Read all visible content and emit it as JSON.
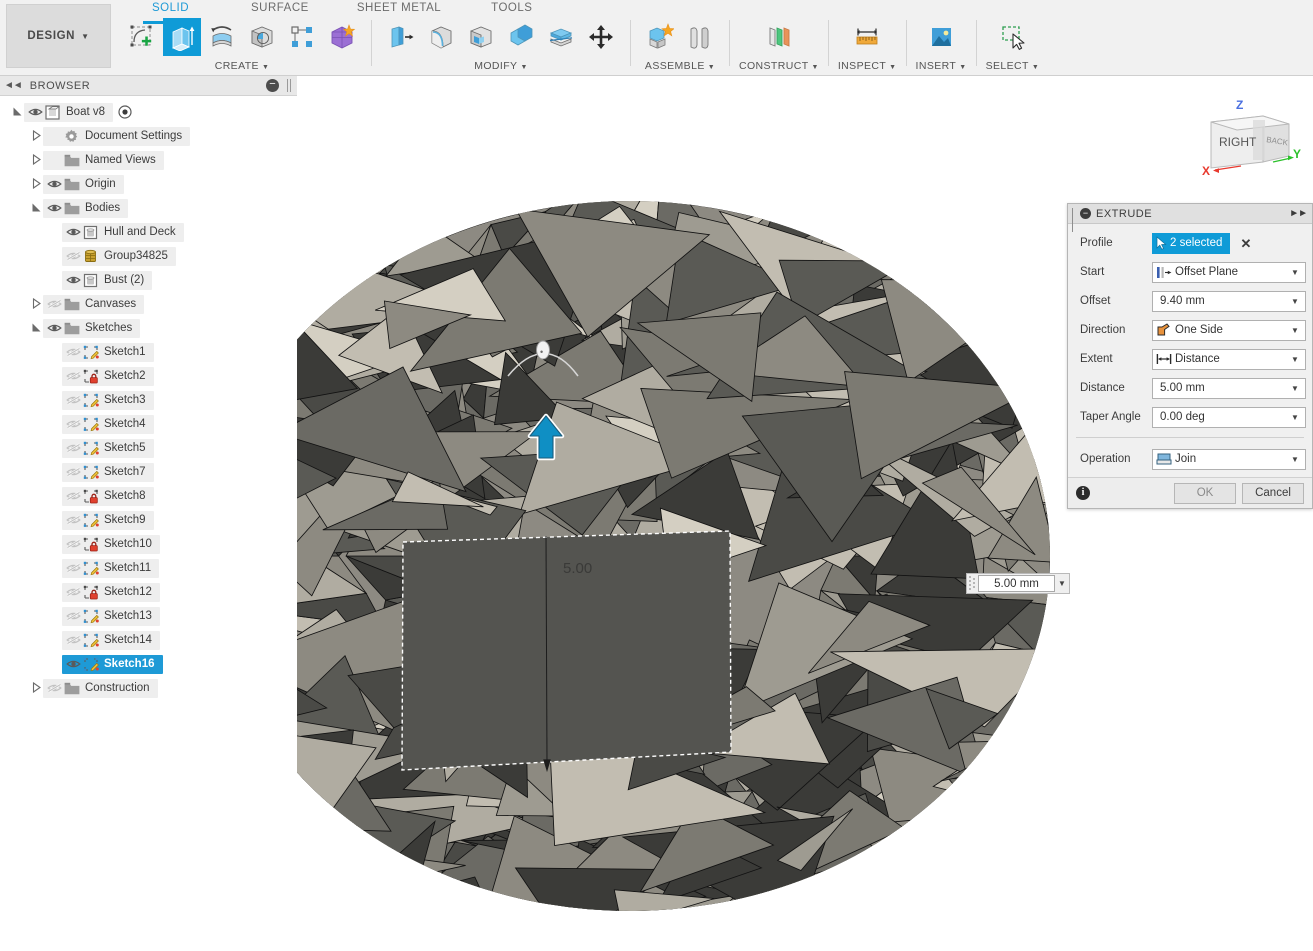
{
  "app": {
    "workspace_button": "DESIGN",
    "tabs": [
      {
        "label": "SOLID",
        "active": true
      },
      {
        "label": "SURFACE",
        "active": false
      },
      {
        "label": "SHEET METAL",
        "active": false
      },
      {
        "label": "TOOLS",
        "active": false
      }
    ],
    "tool_groups": [
      {
        "label": "CREATE",
        "has_caret": true,
        "tools": [
          {
            "name": "create-sketch-icon",
            "selected": false
          },
          {
            "name": "extrude-icon",
            "selected": true
          },
          {
            "name": "revolve-icon",
            "selected": false
          },
          {
            "name": "sweep-icon",
            "selected": false
          },
          {
            "name": "pattern-icon",
            "selected": false
          },
          {
            "name": "form-icon",
            "selected": false
          }
        ]
      },
      {
        "label": "MODIFY",
        "has_caret": true,
        "tools": [
          {
            "name": "press-pull-icon",
            "selected": false
          },
          {
            "name": "fillet-icon",
            "selected": false
          },
          {
            "name": "shell-icon",
            "selected": false
          },
          {
            "name": "combine-icon",
            "selected": false
          },
          {
            "name": "split-face-icon",
            "selected": false
          },
          {
            "name": "move-copy-icon",
            "selected": false
          }
        ]
      },
      {
        "label": "ASSEMBLE",
        "has_caret": true,
        "tools": [
          {
            "name": "new-component-icon",
            "selected": false
          },
          {
            "name": "joint-icon",
            "selected": false
          }
        ]
      },
      {
        "label": "CONSTRUCT",
        "has_caret": true,
        "tools": [
          {
            "name": "offset-plane-icon",
            "selected": false
          }
        ]
      },
      {
        "label": "INSPECT",
        "has_caret": true,
        "tools": [
          {
            "name": "measure-icon",
            "selected": false
          }
        ]
      },
      {
        "label": "INSERT",
        "has_caret": true,
        "tools": [
          {
            "name": "insert-image-icon",
            "selected": false
          }
        ]
      },
      {
        "label": "SELECT",
        "has_caret": true,
        "tools": [
          {
            "name": "select-window-icon",
            "selected": false
          }
        ]
      }
    ]
  },
  "browser": {
    "title": "BROWSER",
    "collapse_icon": "collapse-left-icon",
    "minus_icon": "minus-circle-icon",
    "tree": [
      {
        "label": "Boat v8",
        "indent": 0,
        "expander": "open",
        "eye": "visible",
        "icon": "component-icon",
        "selected": false,
        "extra": "activate-radio-icon"
      },
      {
        "label": "Document Settings",
        "indent": 1,
        "expander": "closed",
        "eye": "none",
        "icon": "gear-icon",
        "selected": false
      },
      {
        "label": "Named Views",
        "indent": 1,
        "expander": "closed",
        "eye": "none",
        "icon": "folder-icon",
        "selected": false
      },
      {
        "label": "Origin",
        "indent": 1,
        "expander": "closed",
        "eye": "visible",
        "icon": "folder-icon",
        "selected": false
      },
      {
        "label": "Bodies",
        "indent": 1,
        "expander": "open",
        "eye": "visible",
        "icon": "folder-icon",
        "selected": false
      },
      {
        "label": "Hull and Deck",
        "indent": 2,
        "expander": "none",
        "eye": "visible",
        "icon": "body-icon",
        "selected": false
      },
      {
        "label": "Group34825",
        "indent": 2,
        "expander": "none",
        "eye": "hidden",
        "icon": "mesh-body-icon",
        "selected": false
      },
      {
        "label": "Bust (2)",
        "indent": 2,
        "expander": "none",
        "eye": "visible",
        "icon": "body-icon",
        "selected": false
      },
      {
        "label": "Canvases",
        "indent": 1,
        "expander": "closed",
        "eye": "hidden",
        "icon": "folder-icon",
        "selected": false
      },
      {
        "label": "Sketches",
        "indent": 1,
        "expander": "open",
        "eye": "visible",
        "icon": "folder-icon",
        "selected": false
      },
      {
        "label": "Sketch1",
        "indent": 2,
        "expander": "none",
        "eye": "hidden",
        "icon": "sketch-icon",
        "selected": false
      },
      {
        "label": "Sketch2",
        "indent": 2,
        "expander": "none",
        "eye": "hidden",
        "icon": "sketch-locked-icon",
        "selected": false
      },
      {
        "label": "Sketch3",
        "indent": 2,
        "expander": "none",
        "eye": "hidden",
        "icon": "sketch-icon",
        "selected": false
      },
      {
        "label": "Sketch4",
        "indent": 2,
        "expander": "none",
        "eye": "hidden",
        "icon": "sketch-icon",
        "selected": false
      },
      {
        "label": "Sketch5",
        "indent": 2,
        "expander": "none",
        "eye": "hidden",
        "icon": "sketch-icon",
        "selected": false
      },
      {
        "label": "Sketch7",
        "indent": 2,
        "expander": "none",
        "eye": "hidden",
        "icon": "sketch-icon",
        "selected": false
      },
      {
        "label": "Sketch8",
        "indent": 2,
        "expander": "none",
        "eye": "hidden",
        "icon": "sketch-locked-icon",
        "selected": false
      },
      {
        "label": "Sketch9",
        "indent": 2,
        "expander": "none",
        "eye": "hidden",
        "icon": "sketch-icon",
        "selected": false
      },
      {
        "label": "Sketch10",
        "indent": 2,
        "expander": "none",
        "eye": "hidden",
        "icon": "sketch-locked-icon",
        "selected": false
      },
      {
        "label": "Sketch11",
        "indent": 2,
        "expander": "none",
        "eye": "hidden",
        "icon": "sketch-icon",
        "selected": false
      },
      {
        "label": "Sketch12",
        "indent": 2,
        "expander": "none",
        "eye": "hidden",
        "icon": "sketch-locked-icon",
        "selected": false
      },
      {
        "label": "Sketch13",
        "indent": 2,
        "expander": "none",
        "eye": "hidden",
        "icon": "sketch-icon",
        "selected": false
      },
      {
        "label": "Sketch14",
        "indent": 2,
        "expander": "none",
        "eye": "hidden",
        "icon": "sketch-icon",
        "selected": false
      },
      {
        "label": "Sketch16",
        "indent": 2,
        "expander": "none",
        "eye": "visible",
        "icon": "sketch-icon",
        "selected": true
      },
      {
        "label": "Construction",
        "indent": 1,
        "expander": "closed",
        "eye": "hidden",
        "icon": "folder-icon",
        "selected": false
      }
    ]
  },
  "viewcube": {
    "face_label": "RIGHT",
    "axis_x": "X",
    "axis_y": "Y",
    "axis_z": "Z",
    "color_x": "#e8392e",
    "color_y": "#2cc12c",
    "color_z": "#4a6fe0"
  },
  "canvas": {
    "dimension_text": "5.00",
    "inline_input_value": "5.00 mm",
    "manipulator_arrow": "extrude-direction-arrow-icon",
    "taper_handle": "taper-angle-handle-icon"
  },
  "dialog": {
    "title": "EXTRUDE",
    "collapse_icon": "minus-circle-icon",
    "expand_icon": "expand-right-icon",
    "rows": [
      {
        "label": "Profile",
        "kind": "selection",
        "value": "2 selected",
        "icon": "cursor-select-icon",
        "clear": "✕"
      },
      {
        "label": "Start",
        "kind": "dropdown",
        "value": "Offset Plane",
        "icon": "offset-plane-icon"
      },
      {
        "label": "Offset",
        "kind": "value",
        "value": "9.40 mm",
        "icon": ""
      },
      {
        "label": "Direction",
        "kind": "dropdown",
        "value": "One Side",
        "icon": "one-side-arrow-icon"
      },
      {
        "label": "Extent",
        "kind": "dropdown",
        "value": "Distance",
        "icon": "distance-arrows-icon"
      },
      {
        "label": "Distance",
        "kind": "value",
        "value": "5.00 mm",
        "icon": ""
      },
      {
        "label": "Taper Angle",
        "kind": "value",
        "value": "0.00 deg",
        "icon": ""
      }
    ],
    "operation": {
      "label": "Operation",
      "value": "Join",
      "icon": "join-operation-icon"
    },
    "footer": {
      "info_icon": "info-icon",
      "ok_label": "OK",
      "cancel_label": "Cancel",
      "ok_enabled": false
    }
  },
  "colors": {
    "accent_blue": "#0f9bd7",
    "selection_blue": "#1e9ad6",
    "toolbar_bg": "#f1f1f1",
    "panel_bg": "#f0f0f0"
  }
}
